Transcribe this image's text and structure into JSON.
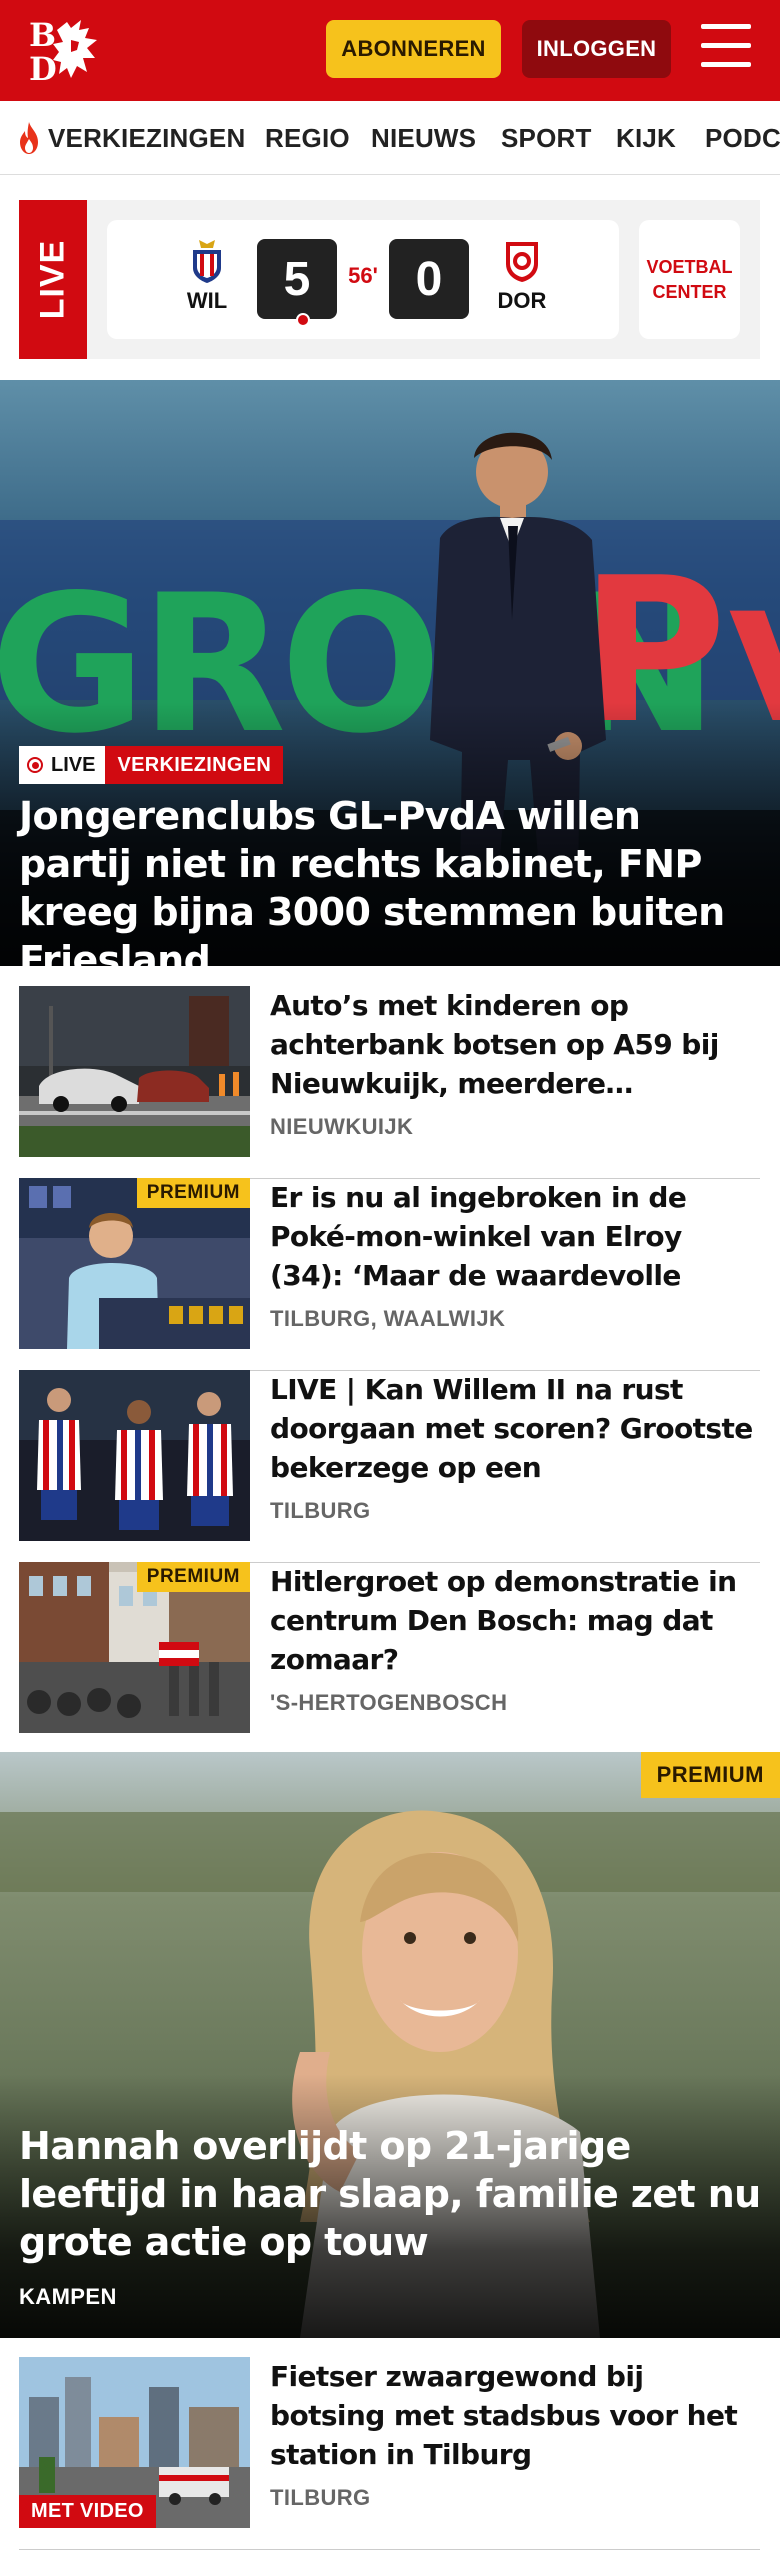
{
  "header": {
    "logo_text": "BD",
    "subscribe_label": "ABONNEREN",
    "login_label": "INLOGGEN",
    "brand_color": "#d10a11",
    "accent_color": "#f6c21c"
  },
  "nav": {
    "items": [
      {
        "label": "VERKIEZINGEN",
        "icon": "flame-icon"
      },
      {
        "label": "REGIO"
      },
      {
        "label": "NIEUWS"
      },
      {
        "label": "SPORT"
      },
      {
        "label": "KIJK"
      },
      {
        "label": "PODC"
      }
    ]
  },
  "live_score": {
    "live_label": "LIVE",
    "home_team": "WIL",
    "away_team": "DOR",
    "home_score": "5",
    "away_score": "0",
    "minute": "56'",
    "voetbal_center": "VOETBAL CENTER"
  },
  "hero": {
    "tag_live": "LIVE",
    "tag_category": "VERKIEZINGEN",
    "title": "Jongerenclubs GL-PvdA willen partij niet in rechts kabinet, FNP kreeg bijna 3000 stemmen buiten Friesland"
  },
  "articles": [
    {
      "title": "Auto’s met kinderen op achterbank botsen op A59 bij Nieuwkuijk, meerdere…",
      "location": "NIEUWKUIJK",
      "premium": ""
    },
    {
      "title": "Er is nu al ingebroken in de Poké-mon-winkel van Elroy (34): ‘Maar de waardevolle kaarten liggen…",
      "location": "TILBURG, WAALWIJK",
      "premium": "PREMIUM"
    },
    {
      "title": "LIVE | Kan Willem II na rust doorgaan met scoren? Grootste bekerzege op een competitiege…",
      "location": "TILBURG",
      "premium": ""
    },
    {
      "title": "Hitlergroet op demonstratie in centrum Den Bosch: mag dat zomaar?",
      "location": "'S-HERTOGENBOSCH",
      "premium": "PREMIUM"
    }
  ],
  "hero2": {
    "premium": "PREMIUM",
    "title": "Hannah overlijdt op 21-jarige leeftijd in haar slaap, familie zet nu grote actie op touw",
    "location": "KAMPEN"
  },
  "articles2": [
    {
      "title": "Fietser zwaargewond bij botsing met stadsbus voor het station in Tilburg",
      "location": "TILBURG",
      "video": "MET VIDEO"
    }
  ]
}
